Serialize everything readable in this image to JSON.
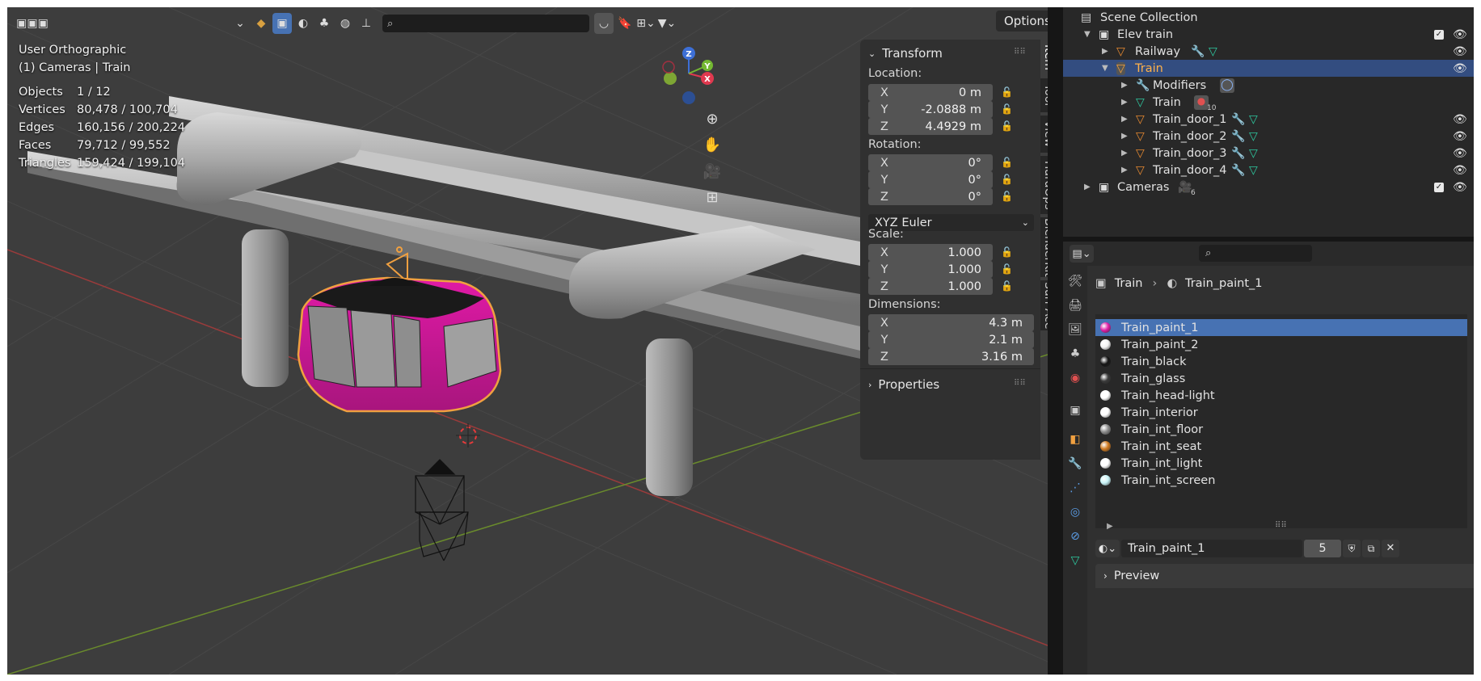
{
  "viewport": {
    "header": {
      "search_placeholder": "",
      "options_label": "Options"
    },
    "overlay": {
      "view_name": "User Orthographic",
      "context": "(1) Cameras | Train",
      "stats": [
        {
          "label": "Objects",
          "value": "1 / 12"
        },
        {
          "label": "Vertices",
          "value": "80,478 / 100,704"
        },
        {
          "label": "Edges",
          "value": "160,156 / 200,224"
        },
        {
          "label": "Faces",
          "value": "79,712 / 99,552"
        },
        {
          "label": "Triangles",
          "value": "159,424 / 199,104"
        }
      ]
    },
    "gizmo": {
      "x": "X",
      "y": "Y",
      "z": "Z"
    }
  },
  "npanel": {
    "transform_title": "Transform",
    "location_label": "Location:",
    "location": [
      {
        "axis": "X",
        "value": "0 m"
      },
      {
        "axis": "Y",
        "value": "-2.0888 m"
      },
      {
        "axis": "Z",
        "value": "4.4929 m"
      }
    ],
    "rotation_label": "Rotation:",
    "rotation": [
      {
        "axis": "X",
        "value": "0°"
      },
      {
        "axis": "Y",
        "value": "0°"
      },
      {
        "axis": "Z",
        "value": "0°"
      }
    ],
    "rotation_mode": "XYZ Euler",
    "scale_label": "Scale:",
    "scale": [
      {
        "axis": "X",
        "value": "1.000"
      },
      {
        "axis": "Y",
        "value": "1.000"
      },
      {
        "axis": "Z",
        "value": "1.000"
      }
    ],
    "dimensions_label": "Dimensions:",
    "dimensions": [
      {
        "axis": "X",
        "value": "4.3 m"
      },
      {
        "axis": "Y",
        "value": "2.1 m"
      },
      {
        "axis": "Z",
        "value": "3.16 m"
      }
    ],
    "properties_title": "Properties",
    "tabs": [
      "Item",
      "Tool",
      "View",
      "HardOps",
      "BlenderKit",
      "Surf Ace"
    ]
  },
  "outliner": {
    "rows": [
      {
        "name": "Scene Collection"
      },
      {
        "name": "Elev train"
      },
      {
        "name": "Railway"
      },
      {
        "name": "Train"
      },
      {
        "name": "Modifiers"
      },
      {
        "name": "Train",
        "badge": "10"
      },
      {
        "name": "Train_door_1"
      },
      {
        "name": "Train_door_2"
      },
      {
        "name": "Train_door_3"
      },
      {
        "name": "Train_door_4"
      },
      {
        "name": "Cameras",
        "badge": "6"
      }
    ]
  },
  "properties": {
    "breadcrumb": {
      "object": "Train",
      "material": "Train_paint_1"
    },
    "materials": [
      {
        "name": "Train_paint_1",
        "color": "#e020a8"
      },
      {
        "name": "Train_paint_2",
        "color": "#f2f2f2"
      },
      {
        "name": "Train_black",
        "color": "#151515"
      },
      {
        "name": "Train_glass",
        "color": "#3a3a3a"
      },
      {
        "name": "Train_head-light",
        "color": "#ffffff"
      },
      {
        "name": "Train_interior",
        "color": "#ffffff"
      },
      {
        "name": "Train_int_floor",
        "color": "#8a8a8a"
      },
      {
        "name": "Train_int_seat",
        "color": "#d07a20"
      },
      {
        "name": "Train_int_light",
        "color": "#ffffff"
      },
      {
        "name": "Train_int_screen",
        "color": "#c8f4f8"
      }
    ],
    "active_material": "Train_paint_1",
    "users": "5",
    "preview_label": "Preview"
  }
}
